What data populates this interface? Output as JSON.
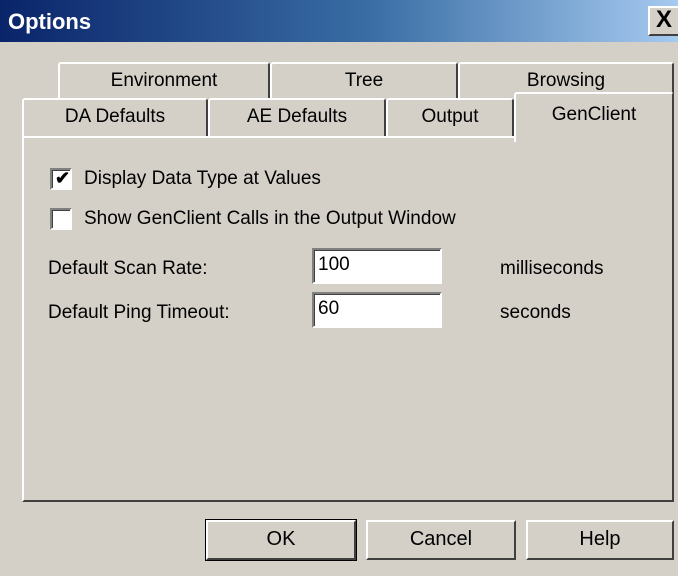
{
  "window": {
    "title": "Options",
    "close_glyph": "X"
  },
  "tabs": {
    "back_row": [
      "Environment",
      "Tree",
      "Browsing"
    ],
    "front_row": [
      "DA Defaults",
      "AE Defaults",
      "Output",
      "GenClient"
    ],
    "active": "GenClient"
  },
  "genclient": {
    "display_data_type": {
      "label": "Display Data Type at Values",
      "checked": true
    },
    "show_calls": {
      "label": "Show GenClient Calls in the Output Window",
      "checked": false
    },
    "scan_rate": {
      "label": "Default Scan Rate:",
      "value": "100",
      "unit": "milliseconds"
    },
    "ping_timeout": {
      "label": "Default Ping Timeout:",
      "value": "60",
      "unit": "seconds"
    }
  },
  "buttons": {
    "ok": "OK",
    "cancel": "Cancel",
    "help": "Help"
  }
}
